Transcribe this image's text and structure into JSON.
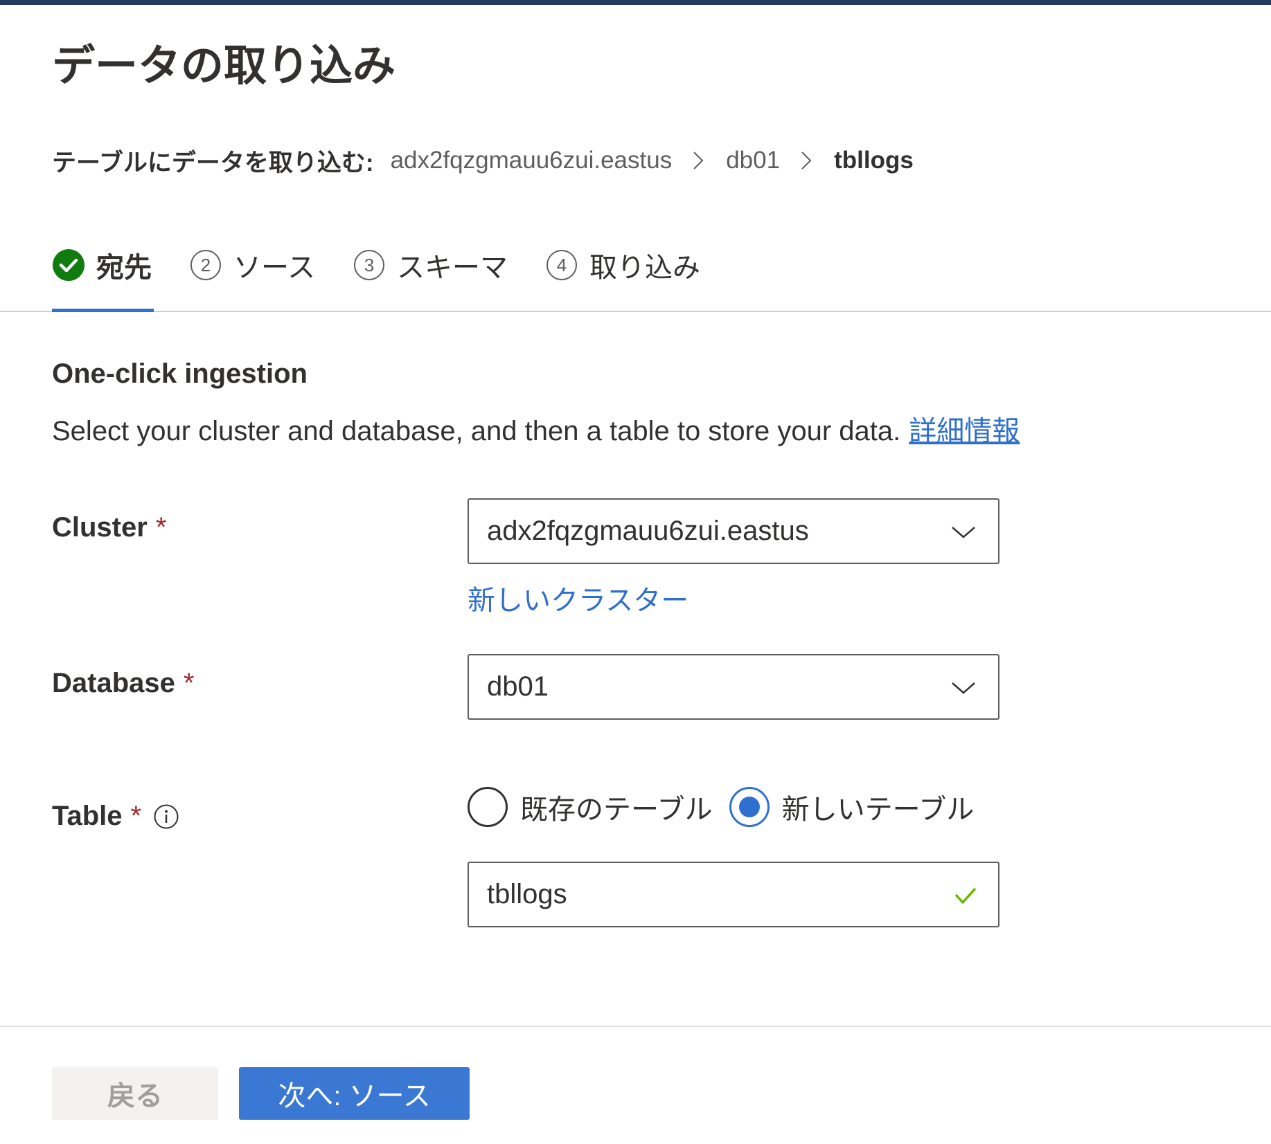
{
  "header": {
    "title": "データの取り込み"
  },
  "breadcrumb": {
    "prefix": "テーブルにデータを取り込む:",
    "items": [
      "adx2fqzgmauu6zui.eastus",
      "db01",
      "tbllogs"
    ]
  },
  "tabs": [
    {
      "number": "",
      "label": "宛先",
      "state": "completed"
    },
    {
      "number": "2",
      "label": "ソース",
      "state": "pending"
    },
    {
      "number": "3",
      "label": "スキーマ",
      "state": "pending"
    },
    {
      "number": "4",
      "label": "取り込み",
      "state": "pending"
    }
  ],
  "section": {
    "title": "One-click ingestion",
    "description": "Select your cluster and database, and then a table to store your data.",
    "learn_more_link": "詳細情報"
  },
  "form": {
    "cluster": {
      "label": "Cluster",
      "required_mark": "*",
      "value": "adx2fqzgmauu6zui.eastus",
      "new_link": "新しいクラスター"
    },
    "database": {
      "label": "Database",
      "required_mark": "*",
      "value": "db01"
    },
    "table": {
      "label": "Table",
      "required_mark": "*",
      "options": [
        {
          "label": "既存のテーブル",
          "selected": false
        },
        {
          "label": "新しいテーブル",
          "selected": true
        }
      ],
      "value": "tbllogs"
    }
  },
  "footer": {
    "back_label": "戻る",
    "next_label": "次へ: ソース"
  },
  "colors": {
    "accent": "#2f6fcf",
    "success": "#107c10",
    "required": "#a4262c",
    "top_bar": "#243a5e"
  },
  "icons": {
    "step_done": "checkmark-circle-icon",
    "breadcrumb_sep": "chevron-right-icon",
    "dropdown": "chevron-down-icon",
    "info": "info-icon",
    "valid": "checkmark-icon"
  }
}
